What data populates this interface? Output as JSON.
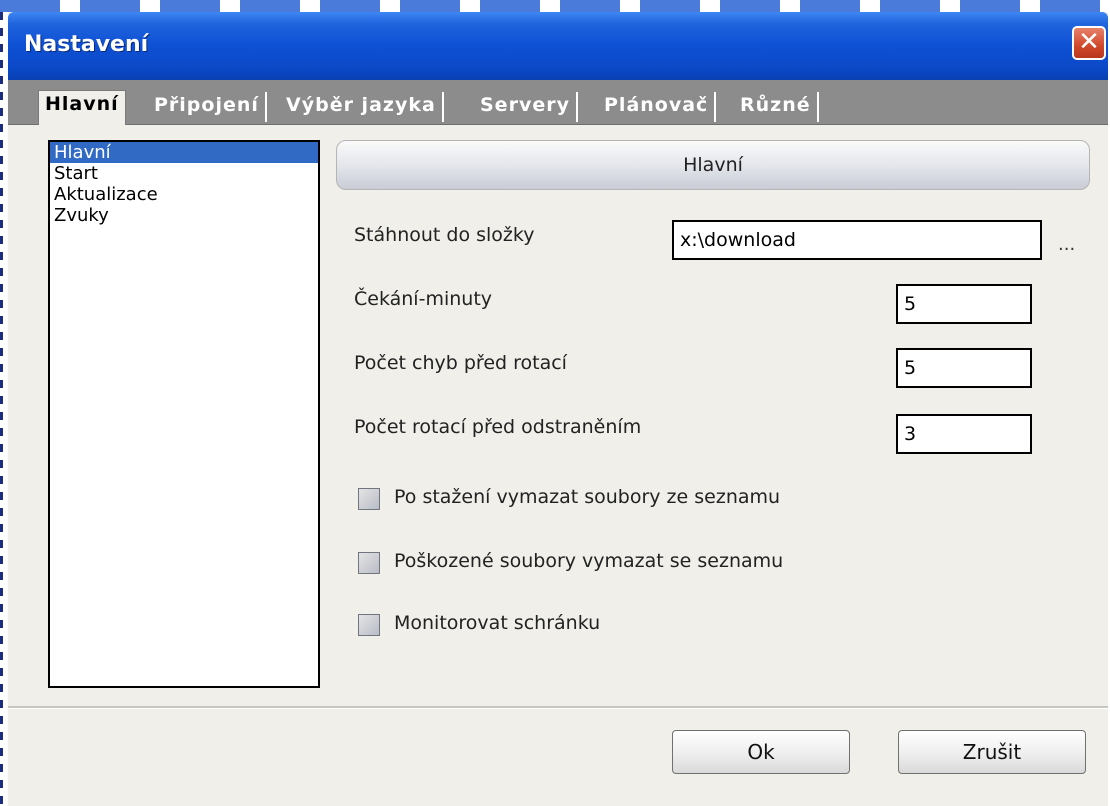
{
  "window": {
    "title": "Nastavení",
    "close_symbol": "✕"
  },
  "tabs": [
    {
      "label": "Hlavní",
      "active": true
    },
    {
      "label": "Připojení",
      "active": false
    },
    {
      "label": "Výběr jazyka",
      "active": false
    },
    {
      "label": "Servery",
      "active": false
    },
    {
      "label": "Plánovač",
      "active": false
    },
    {
      "label": "Různé",
      "active": false
    }
  ],
  "sidebar": {
    "items": [
      {
        "label": "Hlavní",
        "selected": true
      },
      {
        "label": "Start",
        "selected": false
      },
      {
        "label": "Aktualizace",
        "selected": false
      },
      {
        "label": "Zvuky",
        "selected": false
      }
    ]
  },
  "main": {
    "section_title": "Hlavní",
    "download_folder": {
      "label": "Stáhnout do složky",
      "value": "x:\\download",
      "browse_label": "..."
    },
    "wait_minutes": {
      "label": "Čekání-minuty",
      "value": "5"
    },
    "errors_before_rotation": {
      "label": "Počet chyb před rotací",
      "value": "5"
    },
    "rotations_before_removal": {
      "label": "Počet rotací před odstraněním",
      "value": "3"
    },
    "options": [
      {
        "label": "Po stažení vymazat soubory ze seznamu",
        "checked": false
      },
      {
        "label": "Poškozené soubory vymazat se seznamu",
        "checked": false
      },
      {
        "label": "Monitorovat schránku",
        "checked": false
      }
    ]
  },
  "footer": {
    "ok_label": "Ok",
    "cancel_label": "Zrušit"
  },
  "colors": {
    "titlebar": "#0e50d4",
    "tabbar": "#8c8c8c",
    "selection": "#316ac5",
    "dialog_bg": "#f0efe9"
  }
}
